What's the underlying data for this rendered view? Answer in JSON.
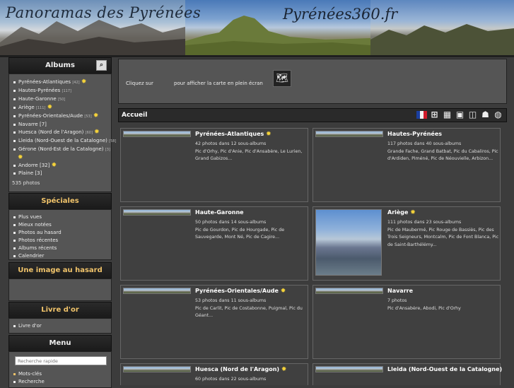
{
  "banner": {
    "title": "Panoramas des Pyrénées",
    "site": "Pyrénées360.fr"
  },
  "sidebar": {
    "albums": {
      "header": "Albums",
      "items": [
        {
          "label": "Pyrénées-Atlantiques",
          "count": "[42]"
        },
        {
          "label": "Hautes-Pyrénées",
          "count": "[117]"
        },
        {
          "label": "Haute-Garonne",
          "count": "[50]"
        },
        {
          "label": "Ariège",
          "count": "[111]"
        },
        {
          "label": "Pyrénées-Orientales/Aude",
          "count": "[53]"
        },
        {
          "label": "Navarre",
          "count": "[7]"
        },
        {
          "label": "Huesca (Nord de l'Aragon)",
          "count": "[60]"
        },
        {
          "label": "Lleida (Nord-Ouest de la Catalogne)",
          "count": "[58]"
        },
        {
          "label": "Gérone (Nord-Est de la Catalogne)",
          "count": "[3]"
        },
        {
          "label": "Andorre",
          "count": "[32]"
        },
        {
          "label": "Plaine",
          "count": "[3]"
        }
      ],
      "total": "535 photos"
    },
    "specials": {
      "header": "Spéciales",
      "items": [
        "Plus vues",
        "Mieux notées",
        "Photos au hasard",
        "Photos récentes",
        "Albums récents",
        "Calendrier"
      ]
    },
    "random": {
      "header": "Une image au hasard"
    },
    "guestbook": {
      "header": "Livre d'or",
      "items": [
        "Livre d'or"
      ]
    },
    "menu": {
      "header": "Menu",
      "search_placeholder": "Recherche rapide",
      "items": [
        "Mots-clés",
        "Recherche"
      ]
    }
  },
  "main": {
    "map": {
      "before": "Cliquez sur",
      "after": "pour afficher la carte en plein écran"
    },
    "section": "Accueil",
    "albums": [
      {
        "title": "Pyrénées-Atlantiques",
        "stats": "42 photos dans 12 sous-albums",
        "desc": "Pic d'Orhy, Pic d'Anie, Pic d'Ansabère, Le Lurien, Grand Gabizos..."
      },
      {
        "title": "Hautes-Pyrénées",
        "stats": "117 photos dans 40 sous-albums",
        "desc": "Grande Fache, Grand Batbat, Pic du Cabaliros, Pic d'Ardiden, Piméné, Pic de Néouvielle, Arbizon..."
      },
      {
        "title": "Haute-Garonne",
        "stats": "50 photos dans 14 sous-albums",
        "desc": "Pic de Gourdon, Pic de Hourgade, Pic de Sauvegarde, Mont Né, Pic de Cagire..."
      },
      {
        "title": "Ariège",
        "stats": "111 photos dans 23 sous-albums",
        "desc": "Pic de Maubermé, Pic Rouge de Bassiès, Pic des Trois Seigneurs, Montcalm, Pic de Font Blanca, Pic de Saint-Barthélémy..."
      },
      {
        "title": "Pyrénées-Orientales/Aude",
        "stats": "53 photos dans 11 sous-albums",
        "desc": "Pic de Carlit, Pic de Costabonne, Puigmal, Pic du Géant..."
      },
      {
        "title": "Navarre",
        "stats": "7 photos",
        "desc": "Pic d'Ansabère, Abodi, Pic d'Orhy"
      },
      {
        "title": "Huesca (Nord de l'Aragon)",
        "stats": "60 photos dans 22 sous-albums",
        "desc": ""
      },
      {
        "title": "Lleida (Nord-Ouest de la Catalogne)",
        "stats": "",
        "desc": ""
      }
    ]
  }
}
